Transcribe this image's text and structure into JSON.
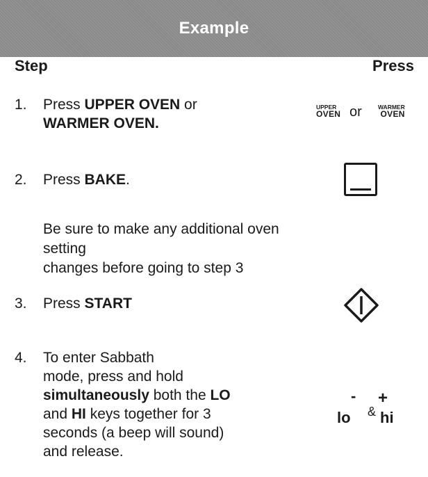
{
  "header": {
    "title": "Example"
  },
  "columns": {
    "step": "Step",
    "press": "Press"
  },
  "steps": [
    {
      "num": "1.",
      "line1": {
        "a": "Press ",
        "b": "UPPER OVEN",
        "c": " or"
      },
      "line2": {
        "b": "WARMER OVEN."
      }
    },
    {
      "num": "2.",
      "line1": {
        "a": "Press ",
        "b": "BAKE",
        "c": "."
      }
    },
    {
      "num": "3.",
      "line1": {
        "a": "Press ",
        "b": "START"
      }
    },
    {
      "num": "4.",
      "lines": {
        "l1": "To enter Sabbath",
        "l2": "mode, press and hold",
        "l3b": "simultaneously",
        "l3c": " both the ",
        "l3d": "LO",
        "l4a": "and ",
        "l4b": "HI",
        "l4c": " keys together for 3",
        "l5": "seconds (a beep will sound)",
        "l6": "and release."
      }
    }
  ],
  "note": {
    "line1": "Be sure to make any additional oven setting",
    "line2": "changes before going to step 3"
  },
  "press_keys": {
    "upper_oven": {
      "top": "UPPER",
      "bottom": "OVEN"
    },
    "or": "or",
    "warmer_oven": {
      "top": "WARMER",
      "bottom": "OVEN"
    },
    "bake_icon": "bake-key-icon",
    "start_icon": "start-diamond-icon",
    "sabbath": {
      "minus": "-",
      "plus": "+",
      "lo": "lo",
      "amp": "&",
      "hi": "hi"
    }
  }
}
